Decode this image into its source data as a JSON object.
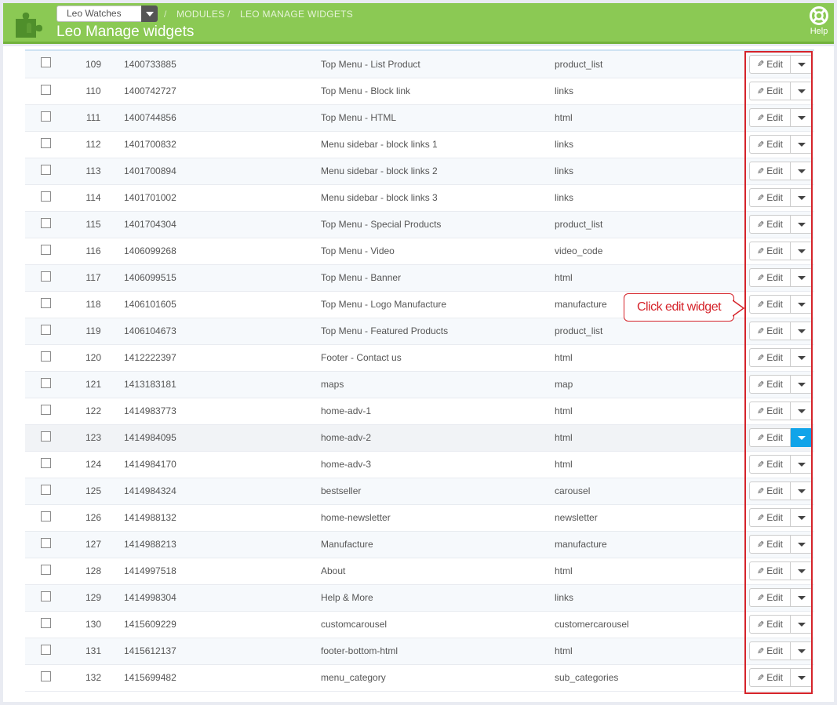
{
  "header": {
    "shop_selector": "Leo Watches",
    "breadcrumb": [
      "MODULES",
      "LEO MANAGE WIDGETS"
    ],
    "page_title": "Leo Manage widgets",
    "help_label": "Help",
    "colors": {
      "header_bg": "#8bc954",
      "header_border": "#72b23c"
    }
  },
  "table": {
    "edit_label": "Edit",
    "rows": [
      {
        "id": "109",
        "key": "1400733885",
        "name": "Top Menu - List Product",
        "type": "product_list"
      },
      {
        "id": "110",
        "key": "1400742727",
        "name": "Top Menu - Block link",
        "type": "links"
      },
      {
        "id": "111",
        "key": "1400744856",
        "name": "Top Menu - HTML",
        "type": "html"
      },
      {
        "id": "112",
        "key": "1401700832",
        "name": "Menu sidebar - block links 1",
        "type": "links"
      },
      {
        "id": "113",
        "key": "1401700894",
        "name": "Menu sidebar - block links 2",
        "type": "links"
      },
      {
        "id": "114",
        "key": "1401701002",
        "name": "Menu sidebar - block links 3",
        "type": "links"
      },
      {
        "id": "115",
        "key": "1401704304",
        "name": "Top Menu - Special Products",
        "type": "product_list"
      },
      {
        "id": "116",
        "key": "1406099268",
        "name": "Top Menu - Video",
        "type": "video_code"
      },
      {
        "id": "117",
        "key": "1406099515",
        "name": "Top Menu - Banner",
        "type": "html"
      },
      {
        "id": "118",
        "key": "1406101605",
        "name": "Top Menu - Logo Manufacture",
        "type": "manufacture"
      },
      {
        "id": "119",
        "key": "1406104673",
        "name": "Top Menu - Featured Products",
        "type": "product_list"
      },
      {
        "id": "120",
        "key": "1412222397",
        "name": "Footer - Contact us",
        "type": "html"
      },
      {
        "id": "121",
        "key": "1413183181",
        "name": "maps",
        "type": "map"
      },
      {
        "id": "122",
        "key": "1414983773",
        "name": "home-adv-1",
        "type": "html"
      },
      {
        "id": "123",
        "key": "1414984095",
        "name": "home-adv-2",
        "type": "html",
        "dropdown_active": true
      },
      {
        "id": "124",
        "key": "1414984170",
        "name": "home-adv-3",
        "type": "html"
      },
      {
        "id": "125",
        "key": "1414984324",
        "name": "bestseller",
        "type": "carousel"
      },
      {
        "id": "126",
        "key": "1414988132",
        "name": "home-newsletter",
        "type": "newsletter"
      },
      {
        "id": "127",
        "key": "1414988213",
        "name": "Manufacture",
        "type": "manufacture"
      },
      {
        "id": "128",
        "key": "1414997518",
        "name": "About",
        "type": "html"
      },
      {
        "id": "129",
        "key": "1414998304",
        "name": "Help & More",
        "type": "links"
      },
      {
        "id": "130",
        "key": "1415609229",
        "name": "customcarousel",
        "type": "customercarousel"
      },
      {
        "id": "131",
        "key": "1415612137",
        "name": "footer-bottom-html",
        "type": "html"
      },
      {
        "id": "132",
        "key": "1415699482",
        "name": "menu_category",
        "type": "sub_categories"
      }
    ]
  },
  "annotation": {
    "callout_text": "Click edit widget",
    "color": "#d5232a"
  }
}
